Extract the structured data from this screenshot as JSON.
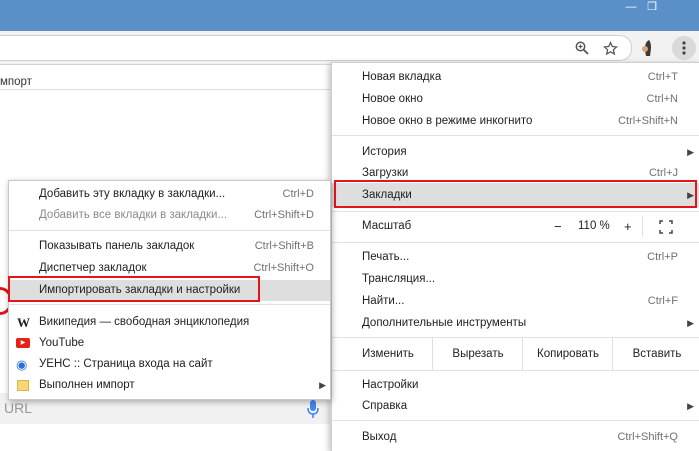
{
  "window": {
    "minimize": "—",
    "maximize": "❐",
    "close": "✕"
  },
  "page": {
    "left_text": "мпорт",
    "url_placeholder": "URL"
  },
  "menu": {
    "items_a": [
      {
        "label": "Новая вкладка",
        "shortcut": "Ctrl+T"
      },
      {
        "label": "Новое окно",
        "shortcut": "Ctrl+N"
      },
      {
        "label": "Новое окно в режиме инкогнито",
        "shortcut": "Ctrl+Shift+N"
      }
    ],
    "items_b": [
      {
        "label": "История",
        "shortcut": ""
      },
      {
        "label": "Загрузки",
        "shortcut": "Ctrl+J"
      },
      {
        "label": "Закладки",
        "shortcut": ""
      }
    ],
    "zoom": {
      "label": "Масштаб",
      "minus": "−",
      "value": "110 %",
      "plus": "+"
    },
    "items_c": [
      {
        "label": "Печать...",
        "shortcut": "Ctrl+P"
      },
      {
        "label": "Трансляция...",
        "shortcut": ""
      },
      {
        "label": "Найти...",
        "shortcut": "Ctrl+F"
      },
      {
        "label": "Дополнительные инструменты",
        "shortcut": ""
      }
    ],
    "edit": {
      "label": "Изменить",
      "cut": "Вырезать",
      "copy": "Копировать",
      "paste": "Вставить"
    },
    "items_d": [
      {
        "label": "Настройки",
        "shortcut": ""
      },
      {
        "label": "Справка",
        "shortcut": ""
      }
    ],
    "exit": {
      "label": "Выход",
      "shortcut": "Ctrl+Shift+Q"
    }
  },
  "submenu": {
    "items_a": [
      {
        "label": "Добавить эту вкладку в закладки...",
        "shortcut": "Ctrl+D"
      },
      {
        "label": "Добавить все вкладки в закладки...",
        "shortcut": "Ctrl+Shift+D"
      }
    ],
    "items_b": [
      {
        "label": "Показывать панель закладок",
        "shortcut": "Ctrl+Shift+B"
      },
      {
        "label": "Диспетчер закладок",
        "shortcut": "Ctrl+Shift+O"
      },
      {
        "label": "Импортировать закладки и настройки",
        "shortcut": ""
      }
    ],
    "bookmarks": [
      {
        "label": "Википедия — свободная энциклопедия",
        "icon": "W"
      },
      {
        "label": "YouTube",
        "icon": "▶"
      },
      {
        "label": "УЕНС :: Страница входа на сайт",
        "icon": "◉"
      },
      {
        "label": "Выполнен импорт",
        "icon": "folder"
      }
    ]
  },
  "colors": {
    "titlebar": "#5b8fc8",
    "highlight_border": "#e0161b",
    "youtube": "#e62117",
    "folder": "#f7d774"
  }
}
